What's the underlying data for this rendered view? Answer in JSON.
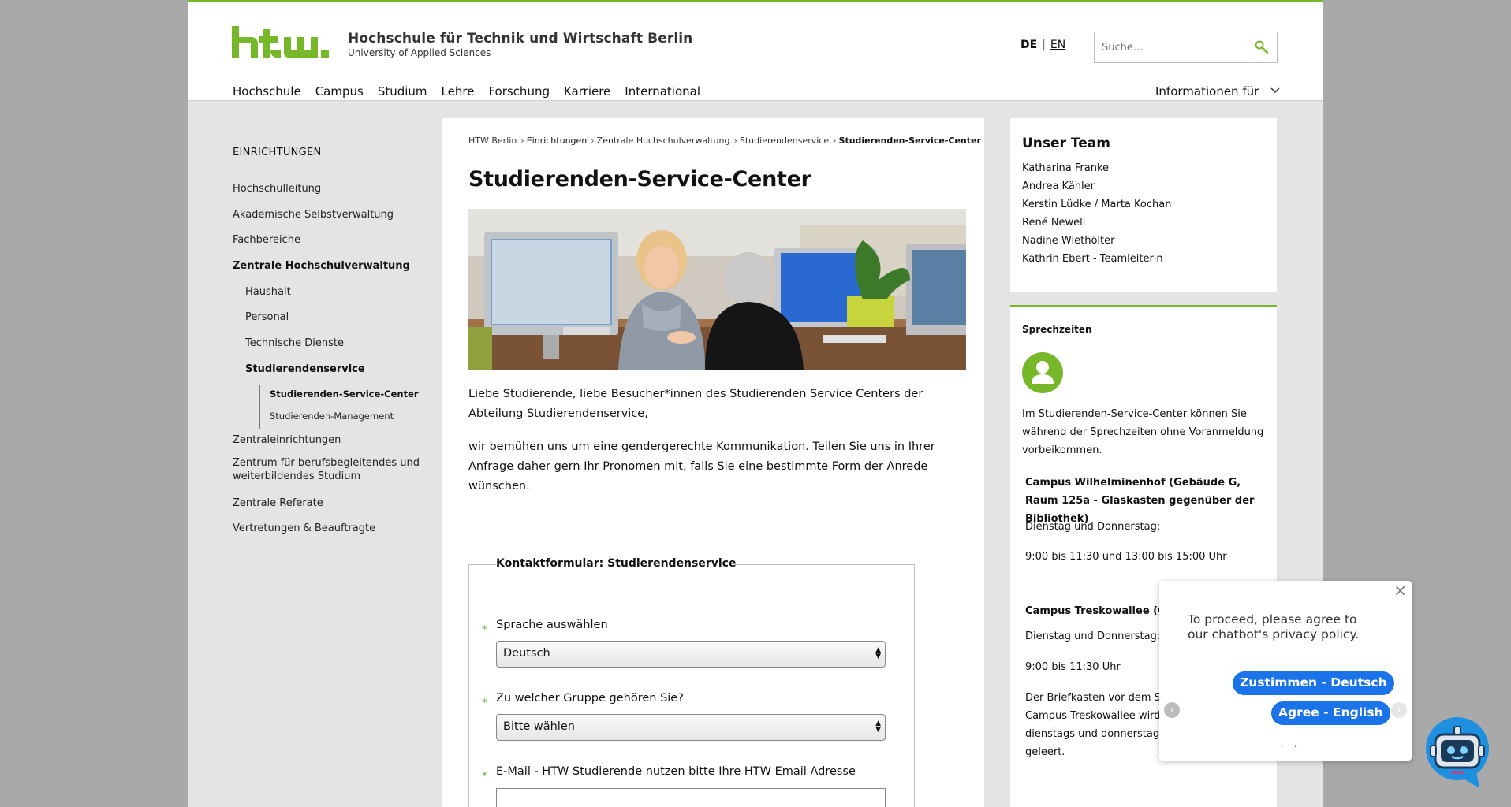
{
  "header": {
    "school_name": "Hochschule für Technik und Wirtschaft Berlin",
    "school_sub": "University of Applied Sciences",
    "lang_de": "DE",
    "lang_sep": "|",
    "lang_en": "EN",
    "search_placeholder": "Suche...",
    "nav": [
      "Hochschule",
      "Campus",
      "Studium",
      "Lehre",
      "Forschung",
      "Karriere",
      "International"
    ],
    "info_for": "Informationen für"
  },
  "sidebar": {
    "heading": "EINRICHTUNGEN",
    "items": [
      "Hochschulleitung",
      "Akademische Selbstverwaltung",
      "Fachbereiche",
      "Zentrale Hochschulverwaltung",
      "Haushalt",
      "Personal",
      "Technische Dienste",
      "Studierendenservice",
      "Studierenden-Service-Center",
      "Studierenden-Management",
      "Zentraleinrichtungen",
      "Zentrum für berufsbegleitendes und weiterbildendes Studium",
      "Zentrale Referate",
      "Vertretungen & Beauftragte"
    ]
  },
  "breadcrumb": [
    "HTW Berlin",
    "Einrichtungen",
    "Zentrale Hochschulverwaltung",
    "Studierendenservice",
    "Studierenden-Service-Center"
  ],
  "main": {
    "title": "Studierenden-Service-Center",
    "para1": "Liebe Studierende, liebe Besucher*innen des Studierenden Service Centers der Abteilung Studierendenservice,",
    "para2": "wir bemühen uns um eine gendergerechte Kommunikation. Teilen Sie uns in Ihrer Anfrage daher gern Ihr Pronomen mit, falls Sie eine bestimmte Form der Anrede wünschen."
  },
  "form": {
    "legend": "Kontaktformular: Studierendenservice",
    "required_mark": "*",
    "lang_label": "Sprache auswählen",
    "lang_value": "Deutsch",
    "group_label": "Zu welcher Gruppe gehören Sie?",
    "group_value": "Bitte wählen",
    "email_label": "E-Mail - HTW Studierende nutzen bitte Ihre HTW Email Adresse"
  },
  "team": {
    "heading": "Unser Team",
    "members": [
      "Katharina Franke",
      "Andrea Kähler",
      "Kerstin Lüdke / Marta Kochan",
      "René Newell",
      "Nadine Wiethölter",
      "Kathrin Ebert - Teamleiterin"
    ]
  },
  "hours": {
    "heading": "Sprechzeiten",
    "intro": "Im Studierenden-Service-Center können Sie während der Sprechzeiten ohne Voranmeldung vorbeikommen.",
    "campus1": "Campus Wilhelminenhof (Gebäude G, Raum 125a - Glaskasten gegenüber der Bibliothek)",
    "days1": "Dienstag und Donnerstag:",
    "times1": "9:00 bis 11:30 und 13:00 bis 15:00 Uhr",
    "campus2": "Campus Treskowallee (Gebäude A, Raum",
    "days2": "Dienstag und Donnerstag:",
    "times2": "9:00 bis 11:30 Uhr",
    "mailbox": "Der Briefkasten vor dem SSC Campus Treskowallee wird dienstags und donnerstags geleert."
  },
  "chatbot": {
    "close": "×",
    "message": "To proceed, please agree to our chatbot's privacy policy.",
    "btn_de": "Zustimmen - Deutsch",
    "btn_en": "Agree - English",
    "prev": "‹",
    "next": "›",
    "dots": "••"
  },
  "colors": {
    "accent": "#76b82a",
    "button": "#1a73e8",
    "bot": "#1f8fe0"
  }
}
